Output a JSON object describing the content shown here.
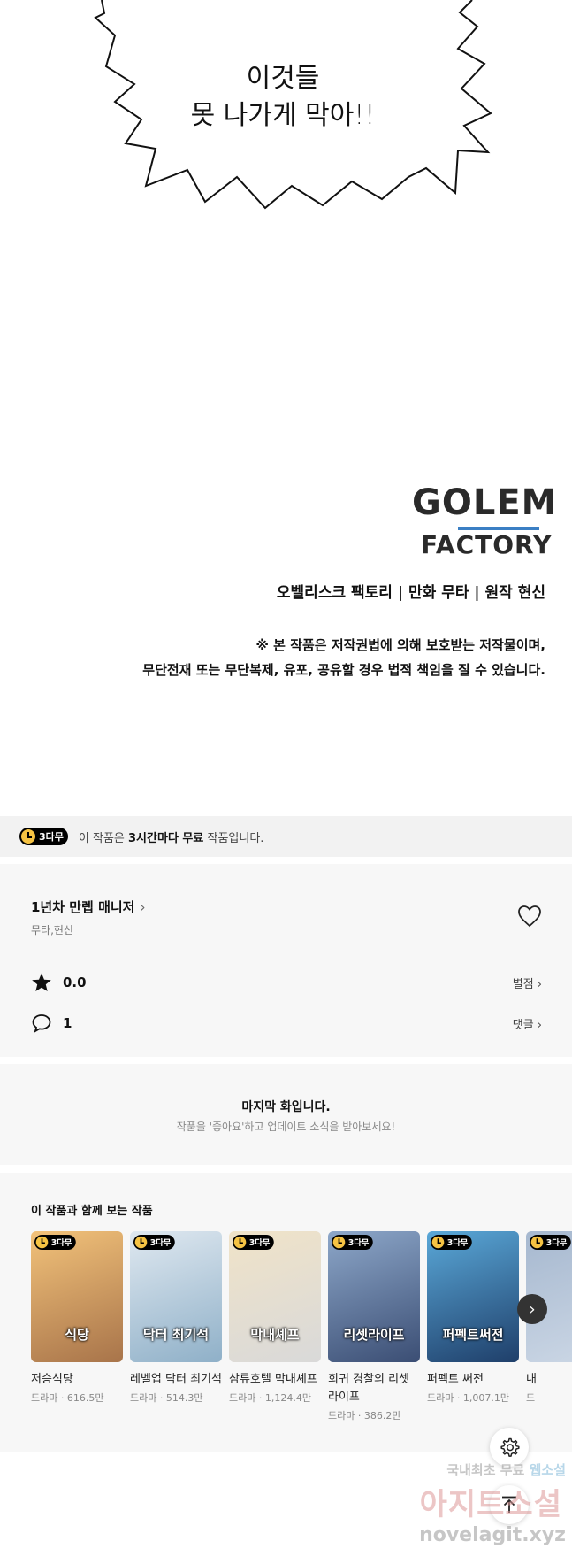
{
  "comic": {
    "speech_line1": "이것들",
    "speech_line2": "못 나가게 막아!!",
    "logo_line1": "GOLEM",
    "logo_line2": "FACTORY",
    "credits": "오벨리스크 팩토리 | 만화 무타 | 원작 현신",
    "copyright_line1": "※ 본 작품은 저작권법에 의해 보호받는 저작물이며,",
    "copyright_line2": "무단전재 또는 무단복제, 유포, 공유할 경우 법적 책임을 질 수 있습니다."
  },
  "notice": {
    "badge": "3다무",
    "text_prefix": "이 작품은 ",
    "text_bold": "3시간마다 무료",
    "text_suffix": " 작품입니다."
  },
  "series": {
    "title": "1년차 만렙 매니저",
    "authors": "무타,현신",
    "rating": "0.0",
    "rating_link": "별점",
    "comments": "1",
    "comments_link": "댓글"
  },
  "last_episode": {
    "title": "마지막 화입니다.",
    "subtitle": "작품을 '좋아요'하고 업데이트 소식을 받아보세요!"
  },
  "recommendations": {
    "heading": "이 작품과 함께 보는 작품",
    "badge": "3다무",
    "items": [
      {
        "title": "저승식당",
        "meta": "드라마 · 616.5만",
        "thumb_text": "식당",
        "bg1": "#a8744a",
        "bg2": "#f2c27a"
      },
      {
        "title": "레벨업 닥터 최기석",
        "meta": "드라마 · 514.3만",
        "thumb_text": "닥터 최기석",
        "bg1": "#8fb0c8",
        "bg2": "#dfe8f0"
      },
      {
        "title": "삼류호텔 막내셰프",
        "meta": "드라마 · 1,124.4만",
        "thumb_text": "막내셰프",
        "bg1": "#d9d9d9",
        "bg2": "#f0e3c8"
      },
      {
        "title": "회귀 경찰의 리셋 라이프",
        "meta": "드라마 · 386.2만",
        "thumb_text": "리셋라이프",
        "bg1": "#3b4e74",
        "bg2": "#8da7c9"
      },
      {
        "title": "퍼펙트 써전",
        "meta": "드라마 · 1,007.1만",
        "thumb_text": "퍼펙트써전",
        "bg1": "#1f3f6a",
        "bg2": "#5aa8d8"
      },
      {
        "title": "내",
        "meta": "드",
        "thumb_text": "",
        "bg1": "#cdd8e6",
        "bg2": "#a6b8cf"
      }
    ]
  },
  "watermark": {
    "line1_a": "국내최초 무료",
    "line1_b": "웹소설",
    "line2": "아지트소설",
    "line3": "novelagit.xyz"
  }
}
